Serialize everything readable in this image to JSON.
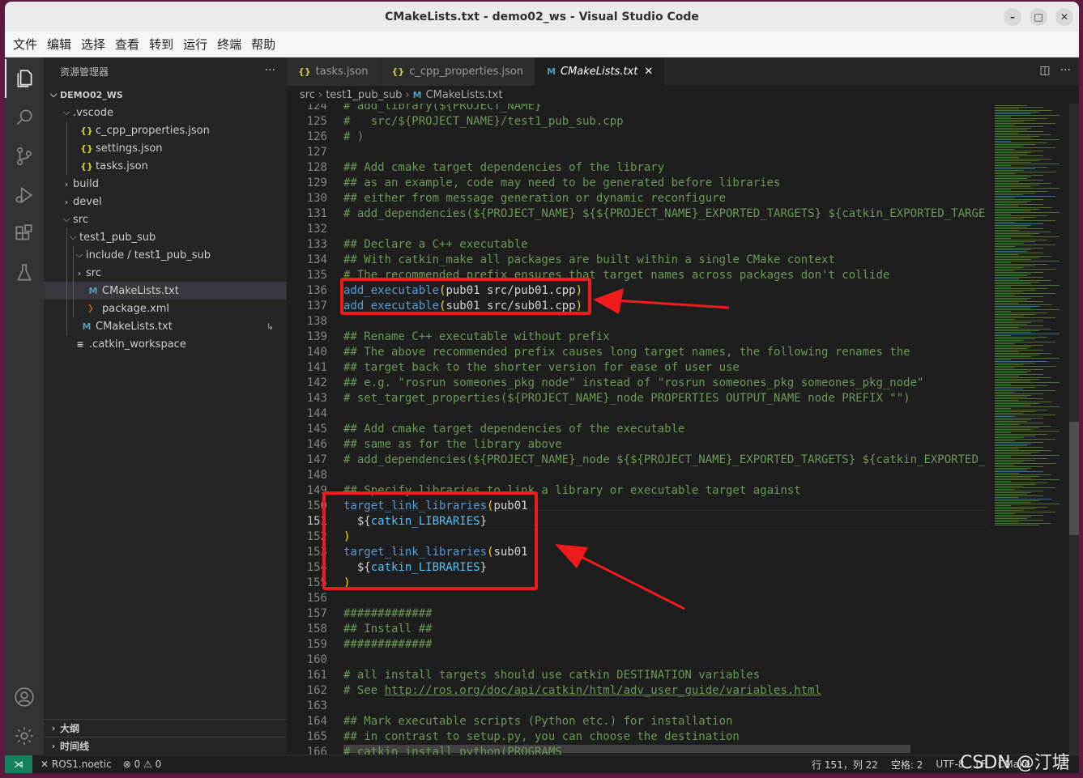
{
  "window": {
    "title": "CMakeLists.txt - demo02_ws - Visual Studio Code"
  },
  "menu": [
    "文件",
    "编辑",
    "选择",
    "查看",
    "转到",
    "运行",
    "终端",
    "帮助"
  ],
  "activity_icons": [
    "files-icon",
    "search-icon",
    "source-control-icon",
    "run-debug-icon",
    "extensions-icon",
    "test-flask-icon",
    "account-icon",
    "settings-gear-icon"
  ],
  "sidebar": {
    "title": "资源管理器",
    "more": "···",
    "workspace": "DEMO02_WS",
    "tree": [
      {
        "label": ".vscode",
        "depth": 1,
        "chev": "down",
        "icon": ""
      },
      {
        "label": "c_cpp_properties.json",
        "depth": 2,
        "chev": "",
        "icon": "{}"
      },
      {
        "label": "settings.json",
        "depth": 2,
        "chev": "",
        "icon": "{}"
      },
      {
        "label": "tasks.json",
        "depth": 2,
        "chev": "",
        "icon": "{}"
      },
      {
        "label": "build",
        "depth": 1,
        "chev": "right",
        "icon": ""
      },
      {
        "label": "devel",
        "depth": 1,
        "chev": "right",
        "icon": ""
      },
      {
        "label": "src",
        "depth": 1,
        "chev": "down",
        "icon": ""
      },
      {
        "label": "test1_pub_sub",
        "depth": 2,
        "chev": "down",
        "icon": ""
      },
      {
        "label": "include / test1_pub_sub",
        "depth": 3,
        "chev": "down",
        "icon": ""
      },
      {
        "label": "src",
        "depth": 3,
        "chev": "right",
        "icon": ""
      },
      {
        "label": "CMakeLists.txt",
        "depth": 3,
        "chev": "",
        "icon": "M",
        "selected": true
      },
      {
        "label": "package.xml",
        "depth": 3,
        "chev": "",
        "icon": "rss"
      },
      {
        "label": "CMakeLists.txt",
        "depth": 2,
        "chev": "",
        "icon": "M",
        "badge": "↳"
      },
      {
        "label": ".catkin_workspace",
        "depth": 1,
        "chev": "",
        "icon": "≡"
      }
    ],
    "outline": "大纲",
    "timeline": "时间线"
  },
  "tabs": [
    {
      "label": "tasks.json",
      "icon": "{}",
      "active": false
    },
    {
      "label": "c_cpp_properties.json",
      "icon": "{}",
      "active": false
    },
    {
      "label": "CMakeLists.txt",
      "icon": "M",
      "active": true,
      "close": "✕"
    }
  ],
  "breadcrumb": [
    "src",
    "test1_pub_sub",
    "CMakeLists.txt"
  ],
  "code": {
    "current_line": 151,
    "lines": [
      {
        "n": 124,
        "segs": [
          [
            "c",
            "# add_library(${PROJECT_NAME}"
          ]
        ]
      },
      {
        "n": 125,
        "segs": [
          [
            "c",
            "#   src/${PROJECT_NAME}/test1_pub_sub.cpp"
          ]
        ]
      },
      {
        "n": 126,
        "segs": [
          [
            "c",
            "# )"
          ]
        ]
      },
      {
        "n": 127,
        "segs": []
      },
      {
        "n": 128,
        "segs": [
          [
            "c",
            "## Add cmake target dependencies of the library"
          ]
        ]
      },
      {
        "n": 129,
        "segs": [
          [
            "c",
            "## as an example, code may need to be generated before libraries"
          ]
        ]
      },
      {
        "n": 130,
        "segs": [
          [
            "c",
            "## either from message generation or dynamic reconfigure"
          ]
        ]
      },
      {
        "n": 131,
        "segs": [
          [
            "c",
            "# add_dependencies(${PROJECT_NAME} ${${PROJECT_NAME}_EXPORTED_TARGETS} ${catkin_EXPORTED_TARGE"
          ]
        ]
      },
      {
        "n": 132,
        "segs": []
      },
      {
        "n": 133,
        "segs": [
          [
            "c",
            "## Declare a C++ executable"
          ]
        ]
      },
      {
        "n": 134,
        "segs": [
          [
            "c",
            "## With catkin_make all packages are built within a single CMake context"
          ]
        ]
      },
      {
        "n": 135,
        "segs": [
          [
            "c",
            "# The recommended prefix ensures that target names across packages don't collide"
          ]
        ]
      },
      {
        "n": 136,
        "segs": [
          [
            "f",
            "add_executable"
          ],
          [
            "p",
            "("
          ],
          [
            "t",
            "pub01 src/pub01.cpp"
          ],
          [
            "p",
            ")"
          ]
        ]
      },
      {
        "n": 137,
        "segs": [
          [
            "f",
            "add_executable"
          ],
          [
            "p",
            "("
          ],
          [
            "t",
            "sub01 src/sub01.cpp"
          ],
          [
            "p",
            ")"
          ]
        ]
      },
      {
        "n": 138,
        "segs": []
      },
      {
        "n": 139,
        "segs": [
          [
            "c",
            "## Rename C++ executable without prefix"
          ]
        ]
      },
      {
        "n": 140,
        "segs": [
          [
            "c",
            "## The above recommended prefix causes long target names, the following renames the"
          ]
        ]
      },
      {
        "n": 141,
        "segs": [
          [
            "c",
            "## target back to the shorter version for ease of user use"
          ]
        ]
      },
      {
        "n": 142,
        "segs": [
          [
            "c",
            "## e.g. \"rosrun someones_pkg node\" instead of \"rosrun someones_pkg someones_pkg_node\""
          ]
        ]
      },
      {
        "n": 143,
        "segs": [
          [
            "c",
            "# set_target_properties(${PROJECT_NAME}_node PROPERTIES OUTPUT_NAME node PREFIX \"\")"
          ]
        ]
      },
      {
        "n": 144,
        "segs": []
      },
      {
        "n": 145,
        "segs": [
          [
            "c",
            "## Add cmake target dependencies of the executable"
          ]
        ]
      },
      {
        "n": 146,
        "segs": [
          [
            "c",
            "## same as for the library above"
          ]
        ]
      },
      {
        "n": 147,
        "segs": [
          [
            "c",
            "# add_dependencies(${PROJECT_NAME}_node ${${PROJECT_NAME}_EXPORTED_TARGETS} ${catkin_EXPORTED_"
          ]
        ]
      },
      {
        "n": 148,
        "segs": []
      },
      {
        "n": 149,
        "segs": [
          [
            "c",
            "## Specify libraries to link a library or executable target against"
          ]
        ]
      },
      {
        "n": 150,
        "segs": [
          [
            "f",
            "target_link_libraries"
          ],
          [
            "p",
            "("
          ],
          [
            "t",
            "pub01"
          ]
        ]
      },
      {
        "n": 151,
        "segs": [
          [
            "t",
            "  ${"
          ],
          [
            "v",
            "catkin_LIBRARIES"
          ],
          [
            "t",
            "}"
          ]
        ]
      },
      {
        "n": 152,
        "segs": [
          [
            "p",
            ")"
          ]
        ]
      },
      {
        "n": 153,
        "segs": [
          [
            "f",
            "target_link_libraries"
          ],
          [
            "p",
            "("
          ],
          [
            "t",
            "sub01"
          ]
        ]
      },
      {
        "n": 154,
        "segs": [
          [
            "t",
            "  ${"
          ],
          [
            "v",
            "catkin_LIBRARIES"
          ],
          [
            "t",
            "}"
          ]
        ]
      },
      {
        "n": 155,
        "segs": [
          [
            "p",
            ")"
          ]
        ]
      },
      {
        "n": 156,
        "segs": []
      },
      {
        "n": 157,
        "segs": [
          [
            "c",
            "#############"
          ]
        ]
      },
      {
        "n": 158,
        "segs": [
          [
            "c",
            "## Install ##"
          ]
        ]
      },
      {
        "n": 159,
        "segs": [
          [
            "c",
            "#############"
          ]
        ]
      },
      {
        "n": 160,
        "segs": []
      },
      {
        "n": 161,
        "segs": [
          [
            "c",
            "# all install targets should use catkin DESTINATION variables"
          ]
        ]
      },
      {
        "n": 162,
        "segs": [
          [
            "c",
            "# See "
          ],
          [
            "lnk",
            "http://ros.org/doc/api/catkin/html/adv_user_guide/variables.html"
          ]
        ]
      },
      {
        "n": 163,
        "segs": []
      },
      {
        "n": 164,
        "segs": [
          [
            "c",
            "## Mark executable scripts (Python etc.) for installation"
          ]
        ]
      },
      {
        "n": 165,
        "segs": [
          [
            "c",
            "## in contrast to setup.py, you can choose the destination"
          ]
        ]
      },
      {
        "n": 166,
        "segs": [
          [
            "c",
            "# catkin_install_python(PROGRAMS"
          ]
        ]
      }
    ]
  },
  "statusbar": {
    "remote_icon": "⋊",
    "branch": "✕ ROS1.noetic",
    "problems": "⊗ 0 ⚠ 0",
    "position": "行 151，列 22",
    "spaces": "空格: 2",
    "encoding": "UTF-8",
    "eol": "LF",
    "language": "CMake"
  },
  "watermark": "CSDN @汀塘",
  "annotation_color": "#ee1c1c"
}
